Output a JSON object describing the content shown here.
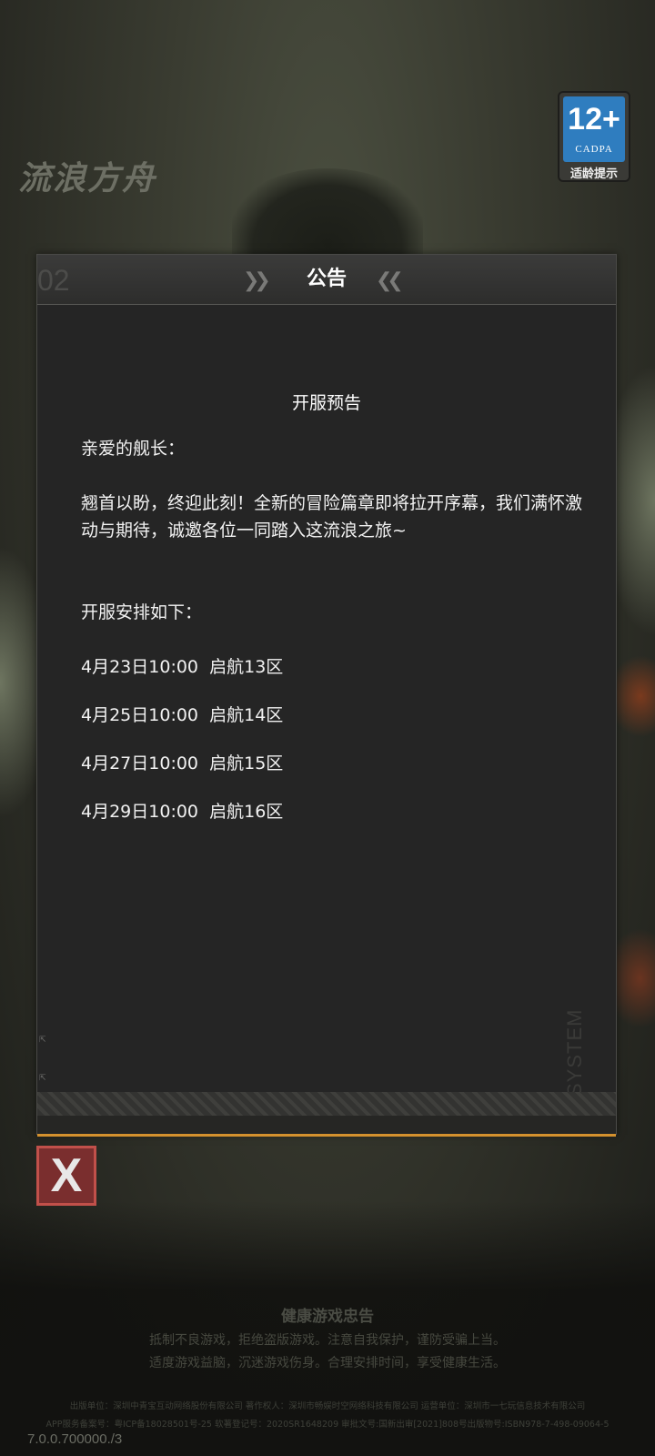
{
  "app": {
    "logo_text": "流浪方舟",
    "age_rating": {
      "number": "12+",
      "org": "CADPA",
      "tip": "适龄提示"
    }
  },
  "dialog": {
    "header_number": "02",
    "title": "公告",
    "heading": "开服预告",
    "greeting": "亲爱的舰长：",
    "body": "翘首以盼，终迎此刻！全新的冒险篇章即将拉开序幕，我们满怀激动与期待，诚邀各位一同踏入这流浪之旅~",
    "schedule_intro": "开服安排如下：",
    "schedule": [
      {
        "time": "4月23日10:00",
        "server": "启航13区"
      },
      {
        "time": "4月25日10:00",
        "server": "启航14区"
      },
      {
        "time": "4月27日10:00",
        "server": "启航15区"
      },
      {
        "time": "4月29日10:00",
        "server": "启航16区"
      }
    ],
    "watermark": "SYSTEM"
  },
  "close_button": {
    "label": "X"
  },
  "footer": {
    "health_title": "健康游戏忠告",
    "health_lines": [
      "抵制不良游戏，拒绝盗版游戏。注意自我保护，谨防受骗上当。",
      "适度游戏益脑，沉迷游戏伤身。合理安排时间，享受健康生活。"
    ],
    "legal_lines": [
      "出版单位：深圳中青宝互动网络股份有限公司 著作权人：深圳市畅娱时空网络科技有限公司 运营单位：深圳市一七玩信息技术有限公司",
      "APP服务备案号：粤ICP备18028501号-25 软著登记号：2020SR1648209 审批文号:国新出审[2021]808号出版物号:ISBN978-7-498-09064-5"
    ],
    "version": "7.0.0.700000./3"
  },
  "colors": {
    "accent": "#d4912e",
    "close_button": "#7a2e2e",
    "age_badge": "#2f7dbf"
  }
}
